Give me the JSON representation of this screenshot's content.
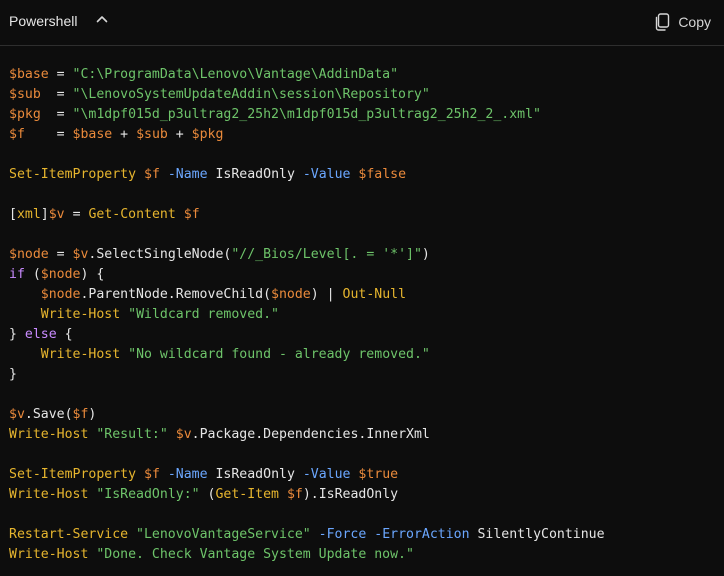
{
  "header": {
    "language": "Powershell",
    "copy_label": "Copy"
  },
  "colors": {
    "background": "#0d0d0d",
    "variable": "#ea8a3b",
    "string": "#6ec46a",
    "cmdlet": "#e6b52e",
    "parameter": "#6ba7ff",
    "keyword": "#c98bff",
    "plain": "#e6e6e6"
  },
  "code_lines": [
    [
      {
        "t": "v",
        "x": "$base"
      },
      {
        "t": "n",
        "x": " = "
      },
      {
        "t": "s",
        "x": "\"C:\\ProgramData\\Lenovo\\Vantage\\AddinData\""
      }
    ],
    [
      {
        "t": "v",
        "x": "$sub"
      },
      {
        "t": "n",
        "x": "  = "
      },
      {
        "t": "s",
        "x": "\"\\LenovoSystemUpdateAddin\\session\\Repository\""
      }
    ],
    [
      {
        "t": "v",
        "x": "$pkg"
      },
      {
        "t": "n",
        "x": "  = "
      },
      {
        "t": "s",
        "x": "\"\\m1dpf015d_p3ultrag2_25h2\\m1dpf015d_p3ultrag2_25h2_2_.xml\""
      }
    ],
    [
      {
        "t": "v",
        "x": "$f"
      },
      {
        "t": "n",
        "x": "    = "
      },
      {
        "t": "v",
        "x": "$base"
      },
      {
        "t": "n",
        "x": " + "
      },
      {
        "t": "v",
        "x": "$sub"
      },
      {
        "t": "n",
        "x": " + "
      },
      {
        "t": "v",
        "x": "$pkg"
      }
    ],
    [],
    [
      {
        "t": "c",
        "x": "Set-ItemProperty"
      },
      {
        "t": "n",
        "x": " "
      },
      {
        "t": "v",
        "x": "$f"
      },
      {
        "t": "n",
        "x": " "
      },
      {
        "t": "p",
        "x": "-Name"
      },
      {
        "t": "n",
        "x": " IsReadOnly "
      },
      {
        "t": "p",
        "x": "-Value"
      },
      {
        "t": "n",
        "x": " "
      },
      {
        "t": "v",
        "x": "$false"
      }
    ],
    [],
    [
      {
        "t": "n",
        "x": "["
      },
      {
        "t": "c",
        "x": "xml"
      },
      {
        "t": "n",
        "x": "]"
      },
      {
        "t": "v",
        "x": "$v"
      },
      {
        "t": "n",
        "x": " = "
      },
      {
        "t": "c",
        "x": "Get-Content"
      },
      {
        "t": "n",
        "x": " "
      },
      {
        "t": "v",
        "x": "$f"
      }
    ],
    [],
    [
      {
        "t": "v",
        "x": "$node"
      },
      {
        "t": "n",
        "x": " = "
      },
      {
        "t": "v",
        "x": "$v"
      },
      {
        "t": "n",
        "x": ".SelectSingleNode("
      },
      {
        "t": "s",
        "x": "\"//_Bios/Level[. = '*']\""
      },
      {
        "t": "n",
        "x": ")"
      }
    ],
    [
      {
        "t": "k",
        "x": "if"
      },
      {
        "t": "n",
        "x": " ("
      },
      {
        "t": "v",
        "x": "$node"
      },
      {
        "t": "n",
        "x": ") {"
      }
    ],
    [
      {
        "t": "n",
        "x": "    "
      },
      {
        "t": "v",
        "x": "$node"
      },
      {
        "t": "n",
        "x": ".ParentNode.RemoveChild("
      },
      {
        "t": "v",
        "x": "$node"
      },
      {
        "t": "n",
        "x": ") | "
      },
      {
        "t": "c",
        "x": "Out-Null"
      }
    ],
    [
      {
        "t": "n",
        "x": "    "
      },
      {
        "t": "c",
        "x": "Write-Host"
      },
      {
        "t": "n",
        "x": " "
      },
      {
        "t": "s",
        "x": "\"Wildcard removed.\""
      }
    ],
    [
      {
        "t": "n",
        "x": "} "
      },
      {
        "t": "k",
        "x": "else"
      },
      {
        "t": "n",
        "x": " {"
      }
    ],
    [
      {
        "t": "n",
        "x": "    "
      },
      {
        "t": "c",
        "x": "Write-Host"
      },
      {
        "t": "n",
        "x": " "
      },
      {
        "t": "s",
        "x": "\"No wildcard found - already removed.\""
      }
    ],
    [
      {
        "t": "n",
        "x": "}"
      }
    ],
    [],
    [
      {
        "t": "v",
        "x": "$v"
      },
      {
        "t": "n",
        "x": ".Save("
      },
      {
        "t": "v",
        "x": "$f"
      },
      {
        "t": "n",
        "x": ")"
      }
    ],
    [
      {
        "t": "c",
        "x": "Write-Host"
      },
      {
        "t": "n",
        "x": " "
      },
      {
        "t": "s",
        "x": "\"Result:\""
      },
      {
        "t": "n",
        "x": " "
      },
      {
        "t": "v",
        "x": "$v"
      },
      {
        "t": "n",
        "x": ".Package.Dependencies.InnerXml"
      }
    ],
    [],
    [
      {
        "t": "c",
        "x": "Set-ItemProperty"
      },
      {
        "t": "n",
        "x": " "
      },
      {
        "t": "v",
        "x": "$f"
      },
      {
        "t": "n",
        "x": " "
      },
      {
        "t": "p",
        "x": "-Name"
      },
      {
        "t": "n",
        "x": " IsReadOnly "
      },
      {
        "t": "p",
        "x": "-Value"
      },
      {
        "t": "n",
        "x": " "
      },
      {
        "t": "v",
        "x": "$true"
      }
    ],
    [
      {
        "t": "c",
        "x": "Write-Host"
      },
      {
        "t": "n",
        "x": " "
      },
      {
        "t": "s",
        "x": "\"IsReadOnly:\""
      },
      {
        "t": "n",
        "x": " ("
      },
      {
        "t": "c",
        "x": "Get-Item"
      },
      {
        "t": "n",
        "x": " "
      },
      {
        "t": "v",
        "x": "$f"
      },
      {
        "t": "n",
        "x": ").IsReadOnly"
      }
    ],
    [],
    [
      {
        "t": "c",
        "x": "Restart-Service"
      },
      {
        "t": "n",
        "x": " "
      },
      {
        "t": "s",
        "x": "\"LenovoVantageService\""
      },
      {
        "t": "n",
        "x": " "
      },
      {
        "t": "p",
        "x": "-Force"
      },
      {
        "t": "n",
        "x": " "
      },
      {
        "t": "p",
        "x": "-ErrorAction"
      },
      {
        "t": "n",
        "x": " SilentlyContinue"
      }
    ],
    [
      {
        "t": "c",
        "x": "Write-Host"
      },
      {
        "t": "n",
        "x": " "
      },
      {
        "t": "s",
        "x": "\"Done. Check Vantage System Update now.\""
      }
    ]
  ]
}
